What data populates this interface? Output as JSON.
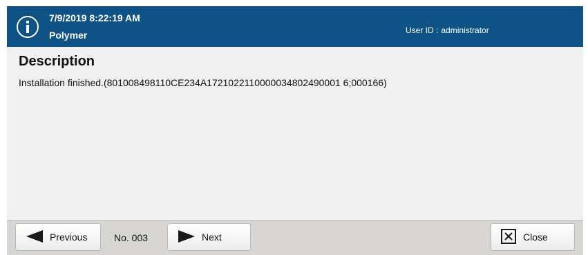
{
  "header": {
    "datetime": "7/9/2019 8:22:19 AM",
    "source": "Polymer",
    "user_label": "User ID :",
    "user_value": "administrator",
    "icon": "info-icon",
    "background_color": "#0f5386"
  },
  "body": {
    "title": "Description",
    "text": "Installation finished.(801008498110CE234A1721022110000034802490001 6;000166)"
  },
  "footer": {
    "prev_label": "Previous",
    "page_no": "No. 003",
    "next_label": "Next",
    "close_label": "Close",
    "prev_icon": "arrow-left-icon",
    "next_icon": "arrow-right-icon",
    "close_icon": "close-box-icon"
  }
}
